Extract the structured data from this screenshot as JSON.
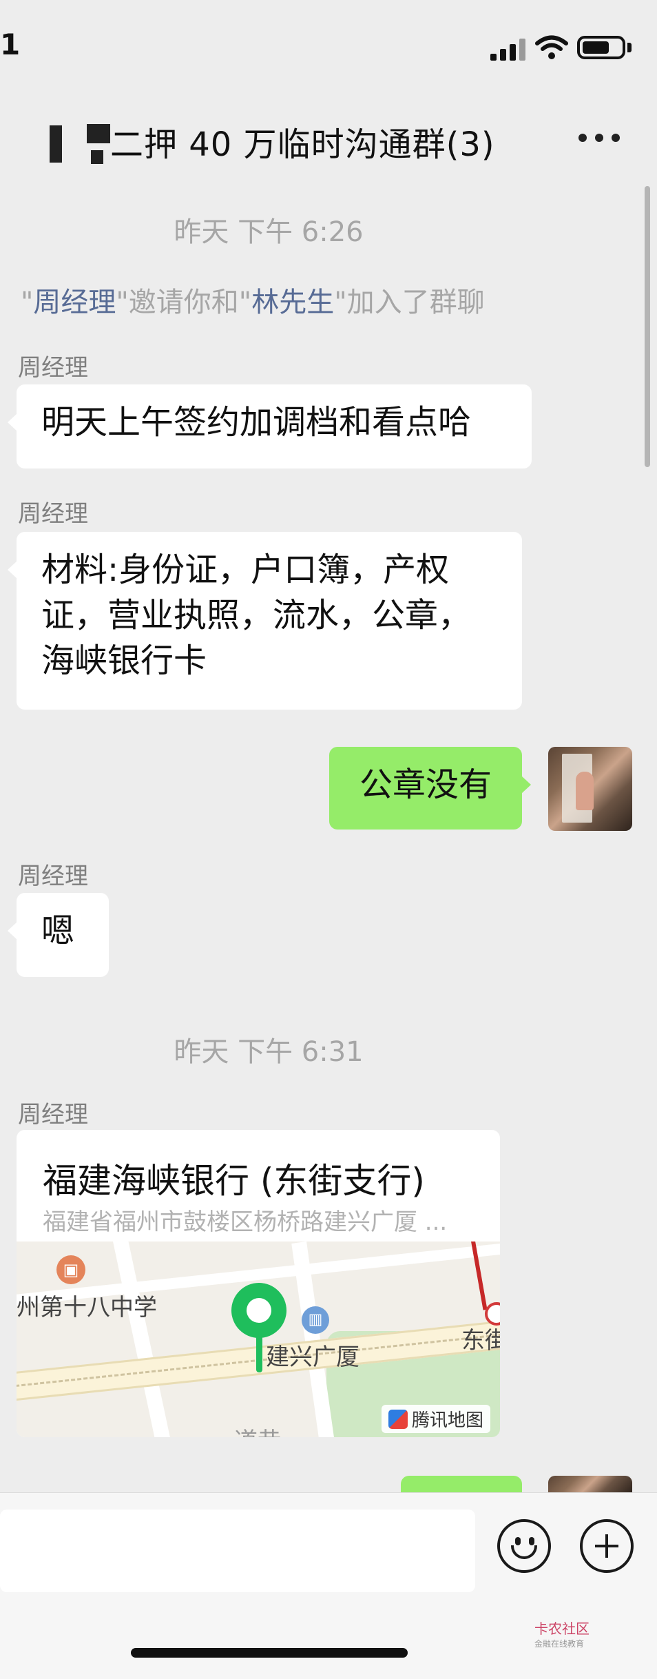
{
  "status_bar": {
    "time": "1"
  },
  "header": {
    "title": "二押 40 万临时沟通群(3)"
  },
  "messages": {
    "timestamp1": "昨天 下午 6:26",
    "system": {
      "q1": "\"",
      "name1": "周经理",
      "q2": "\"邀请你和\"",
      "name2": "林先生",
      "q3": "\"加入了群聊"
    },
    "m1": {
      "sender": "周经理",
      "text": "明天上午签约加调档和看点哈"
    },
    "m2": {
      "sender": "周经理",
      "line1": "材料:身份证，户口簿，产权",
      "line2": "证，营业执照，流水，公章，",
      "line3": "海峡银行卡"
    },
    "m3": {
      "text": "公章没有"
    },
    "m4": {
      "sender": "周经理",
      "text": "嗯"
    },
    "timestamp2": "昨天 下午 6:31",
    "m5": {
      "sender": "周经理",
      "location_name": "福建海峡银行 (东街支行)",
      "location_address": "福建省福州市鼓楼区杨桥路建兴广厦 ...",
      "map_labels": {
        "school": "州第十八中学",
        "building": "建兴广厦",
        "street": "东街",
        "partial": "道巷"
      },
      "map_provider": "腾讯地图"
    }
  },
  "watermark": {
    "main": "卡农社区",
    "sub": "金融在线教育"
  }
}
